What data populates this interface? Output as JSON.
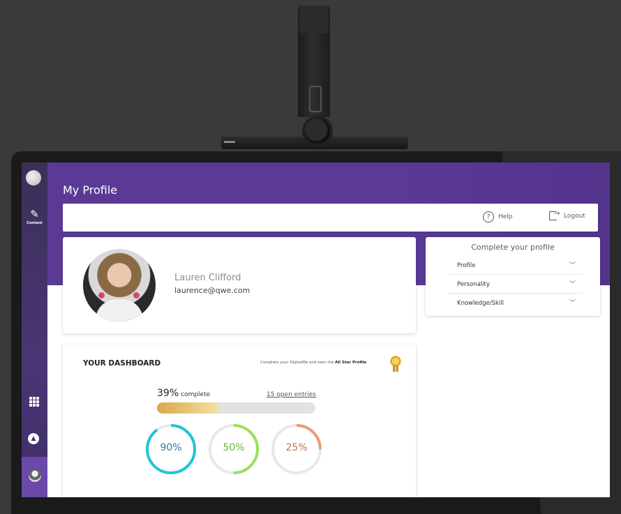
{
  "page": {
    "title": "My Profile"
  },
  "topbar": {
    "help_label": "Help",
    "logout_label": "Logout"
  },
  "sidebar": {
    "content_label": "Content",
    "icons": [
      "pencil-icon",
      "grid-icon",
      "bell-icon",
      "user-avatar"
    ]
  },
  "profile": {
    "name": "Lauren Clifford",
    "email": "laurence@qwe.com"
  },
  "complete_profile": {
    "title": "Complete your profile",
    "items": [
      {
        "label": "Profile"
      },
      {
        "label": "Personality"
      },
      {
        "label": "Knowledge/Skill"
      }
    ]
  },
  "dashboard": {
    "title": "YOUR DASHBOARD",
    "promo_text": "Complete your DigitalMe and earn the",
    "promo_bold": "All Star Profile",
    "percent_label": "39%",
    "percent_word": "complete",
    "progress": 0.39,
    "open_entries": "15 open entries",
    "rings": [
      {
        "label": "90%",
        "value": 0.9,
        "color": "#22c3dc"
      },
      {
        "label": "50%",
        "value": 0.5,
        "color": "#9be05a"
      },
      {
        "label": "25%",
        "value": 0.25,
        "color": "#ee9a7a"
      }
    ]
  },
  "colors": {
    "purple": "#5a3a95",
    "ring_text": [
      "#2a7e95",
      "#63b531",
      "#c7714f"
    ]
  }
}
